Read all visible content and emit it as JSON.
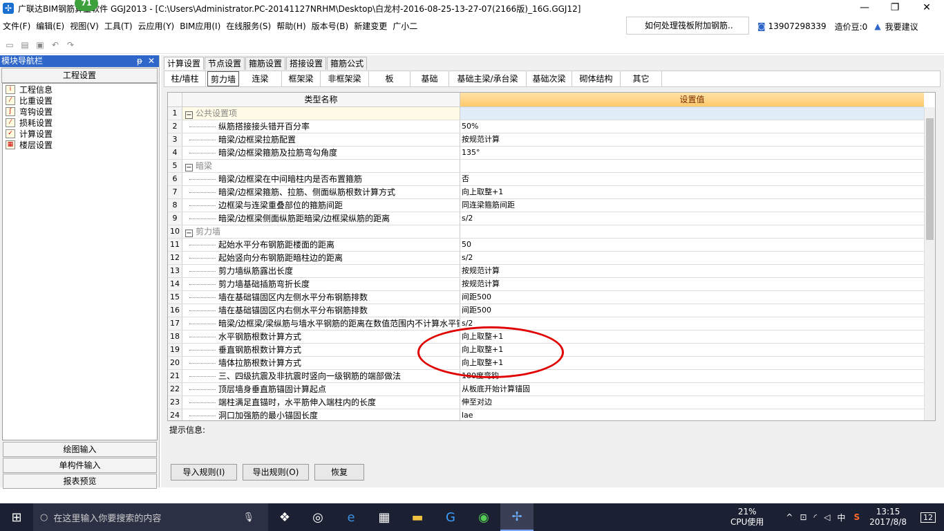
{
  "window": {
    "title": "广联达BIM钢筋算量软件 GGJ2013 - [C:\\Users\\Administrator.PC-20141127NRHM\\Desktop\\白龙村-2016-08-25-13-27-07(2166版)_16G.GGJ12]",
    "badge": "71",
    "min": "—",
    "restore": "❐",
    "close": "✕"
  },
  "menu": {
    "items": [
      "文件(F)",
      "编辑(E)",
      "视图(V)",
      "工具(T)",
      "云应用(Y)",
      "BIM应用(I)",
      "在线服务(S)",
      "帮助(H)",
      "版本号(B)",
      "新建变更",
      "广小二"
    ],
    "help_box": "如何处理筏板附加钢筋..",
    "phone": "13907298339",
    "coins": "造价豆:0",
    "suggest": "我要建议"
  },
  "sidebar": {
    "title": "模块导航栏",
    "pin": "ᵽ",
    "close": "✕",
    "section": "工程设置",
    "items": [
      "工程信息",
      "比重设置",
      "弯钩设置",
      "损耗设置",
      "计算设置",
      "楼层设置"
    ],
    "bottom": [
      "绘图输入",
      "单构件输入",
      "报表预览"
    ]
  },
  "tabs": {
    "top": [
      "计算设置",
      "节点设置",
      "箍筋设置",
      "搭接设置",
      "箍筋公式"
    ],
    "sub": [
      "柱/墙柱",
      "剪力墙",
      "连梁",
      "框架梁",
      "非框架梁",
      "板",
      "基础",
      "基础主梁/承台梁",
      "基础次梁",
      "砌体结构",
      "其它"
    ]
  },
  "grid": {
    "col_name": "类型名称",
    "col_value": "设置值",
    "rows": [
      {
        "n": "1",
        "name": "公共设置项",
        "value": "",
        "group": true
      },
      {
        "n": "2",
        "name": "纵筋搭接接头错开百分率",
        "value": "50%"
      },
      {
        "n": "3",
        "name": "暗梁/边框梁拉筋配置",
        "value": "按规范计算"
      },
      {
        "n": "4",
        "name": "暗梁/边框梁箍筋及拉筋弯勾角度",
        "value": "135°"
      },
      {
        "n": "5",
        "name": "暗梁",
        "value": "",
        "group": true
      },
      {
        "n": "6",
        "name": "暗梁/边框梁在中间暗柱内是否布置箍筋",
        "value": "否"
      },
      {
        "n": "7",
        "name": "暗梁/边框梁箍筋、拉筋、侧面纵筋根数计算方式",
        "value": "向上取整+1"
      },
      {
        "n": "8",
        "name": "边框梁与连梁重叠部位的箍筋间距",
        "value": "同连梁箍筋间距"
      },
      {
        "n": "9",
        "name": "暗梁/边框梁侧面纵筋距暗梁/边框梁纵筋的距离",
        "value": "s/2"
      },
      {
        "n": "10",
        "name": "剪力墙",
        "value": "",
        "group": true
      },
      {
        "n": "11",
        "name": "起始水平分布钢筋距楼面的距离",
        "value": "50"
      },
      {
        "n": "12",
        "name": "起始竖向分布钢筋距暗柱边的距离",
        "value": "s/2"
      },
      {
        "n": "13",
        "name": "剪力墙纵筋露出长度",
        "value": "按规范计算"
      },
      {
        "n": "14",
        "name": "剪力墙基础插筋弯折长度",
        "value": "按规范计算"
      },
      {
        "n": "15",
        "name": "墙在基础锚固区内左侧水平分布钢筋排数",
        "value": "间距500"
      },
      {
        "n": "16",
        "name": "墙在基础锚固区内右侧水平分布钢筋排数",
        "value": "间距500"
      },
      {
        "n": "17",
        "name": "暗梁/边框梁/梁纵筋与墙水平钢筋的距离在数值范围内不计算水平钢",
        "value": "s/2"
      },
      {
        "n": "18",
        "name": "水平钢筋根数计算方式",
        "value": "向上取整+1"
      },
      {
        "n": "19",
        "name": "垂直钢筋根数计算方式",
        "value": "向上取整+1"
      },
      {
        "n": "20",
        "name": "墙体拉筋根数计算方式",
        "value": "向上取整+1"
      },
      {
        "n": "21",
        "name": "三、四级抗震及非抗震时竖向一级钢筋的端部做法",
        "value": "180度弯钩"
      },
      {
        "n": "22",
        "name": "顶层墙身垂直筋锚固计算起点",
        "value": "从板底开始计算锚固"
      },
      {
        "n": "23",
        "name": "端柱满足直锚时，水平筋伸入端柱内的长度",
        "value": "伸至对边"
      },
      {
        "n": "24",
        "name": "洞口加强筋的最小锚固长度",
        "value": "lae"
      }
    ]
  },
  "hint_label": "提示信息:",
  "buttons": {
    "import": "导入规则(I)",
    "export": "导出规则(O)",
    "restore": "恢复"
  },
  "taskbar": {
    "search_placeholder": "在这里输入你要搜索的内容",
    "cpu": "21%",
    "cpu_label": "CPU使用",
    "ime": "中",
    "time": "13:15",
    "date": "2017/8/8",
    "notif": "12"
  }
}
